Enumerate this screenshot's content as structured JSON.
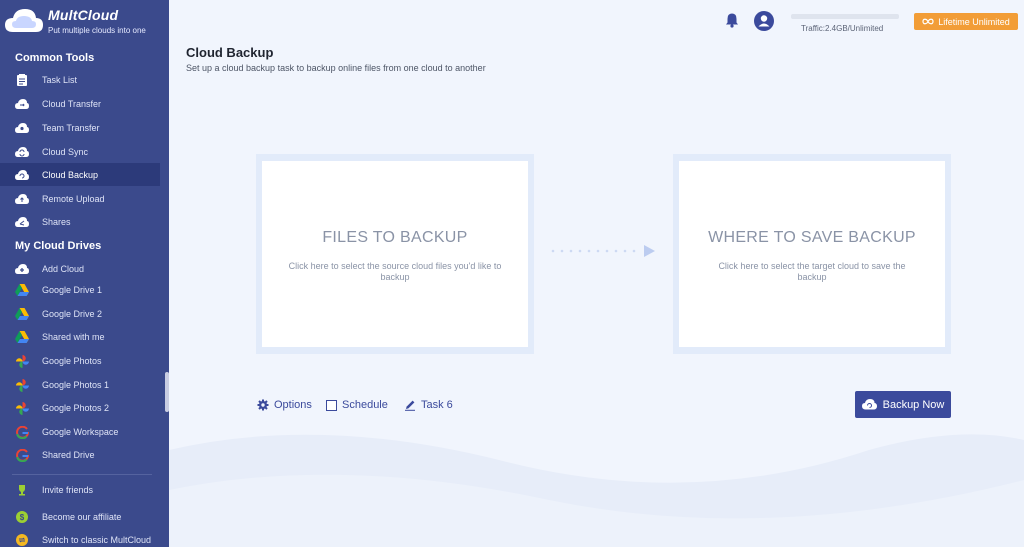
{
  "app": {
    "logo_name": "MultCloud",
    "logo_tagline": "Put multiple clouds into one"
  },
  "sidebar": {
    "common_tools_title": "Common Tools",
    "common_tools": [
      {
        "label": "Task List",
        "icon": "task-list-icon"
      },
      {
        "label": "Cloud Transfer",
        "icon": "cloud-transfer-icon"
      },
      {
        "label": "Team Transfer",
        "icon": "team-transfer-icon"
      },
      {
        "label": "Cloud Sync",
        "icon": "cloud-sync-icon"
      },
      {
        "label": "Cloud Backup",
        "icon": "cloud-backup-icon",
        "active": true
      },
      {
        "label": "Remote Upload",
        "icon": "remote-upload-icon"
      },
      {
        "label": "Shares",
        "icon": "shares-icon"
      }
    ],
    "my_cloud_drives_title": "My Cloud Drives",
    "drives": [
      {
        "label": "Add Cloud",
        "icon": "add-cloud-icon"
      },
      {
        "label": "Google Drive 1",
        "icon": "google-drive-icon"
      },
      {
        "label": "Google Drive 2",
        "icon": "google-drive-icon"
      },
      {
        "label": "Shared with me",
        "icon": "google-drive-icon"
      },
      {
        "label": "Google Photos",
        "icon": "google-photos-icon"
      },
      {
        "label": "Google Photos 1",
        "icon": "google-photos-icon"
      },
      {
        "label": "Google Photos 2",
        "icon": "google-photos-icon"
      },
      {
        "label": "Google Workspace",
        "icon": "google-g-icon"
      },
      {
        "label": "Shared Drive",
        "icon": "google-g-icon"
      }
    ],
    "footer": [
      {
        "label": "Invite friends",
        "icon": "trophy-icon"
      },
      {
        "label": "Become our affiliate",
        "icon": "dollar-icon"
      },
      {
        "label": "Switch to classic MultCloud",
        "icon": "switch-icon"
      }
    ]
  },
  "topbar": {
    "traffic_text": "Traffic:2.4GB/Unlimited",
    "lifetime_label": "Lifetime Unlimited"
  },
  "page": {
    "title": "Cloud Backup",
    "subtitle": "Set up a cloud backup task to backup online files from one cloud to another"
  },
  "source_panel": {
    "title": "FILES TO BACKUP",
    "description": "Click here to select the source cloud files you'd like to backup"
  },
  "target_panel": {
    "title": "WHERE TO SAVE BACKUP",
    "description": "Click here to select the target cloud to save the backup"
  },
  "toolbar": {
    "options_label": "Options",
    "schedule_label": "Schedule",
    "task_name": "Task 6",
    "backup_now_label": "Backup Now"
  },
  "colors": {
    "sidebar_bg": "#3b4a8c",
    "accent": "#3b4a9c",
    "lifetime_orange": "#f29d37",
    "page_bg": "#f1f5fd"
  }
}
